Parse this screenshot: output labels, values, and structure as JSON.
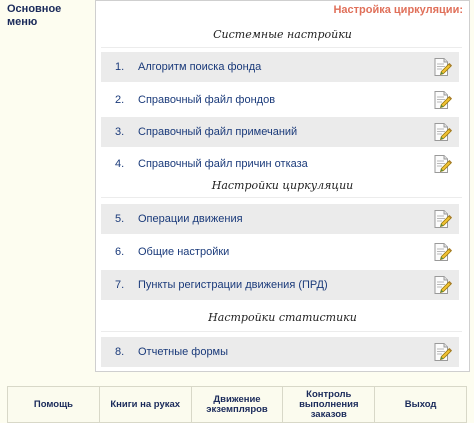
{
  "side_menu": {
    "title": "Основное меню"
  },
  "page_title": "Настройка циркуляции:",
  "sections": [
    {
      "title": "Системные настройки",
      "items": [
        {
          "num": "1.",
          "label": "Алгоритм поиска фонда"
        },
        {
          "num": "2.",
          "label": "Справочный файл фондов"
        },
        {
          "num": "3.",
          "label": "Справочный файл примечаний"
        },
        {
          "num": "4.",
          "label": "Справочный файл причин отказа"
        }
      ]
    },
    {
      "title": "Настройки циркуляции",
      "items": [
        {
          "num": "5.",
          "label": "Операции движения"
        },
        {
          "num": "6.",
          "label": "Общие настройки"
        },
        {
          "num": "7.",
          "label": "Пункты регистрации движения (ПРД)"
        }
      ]
    },
    {
      "title": "Настройки статистики",
      "items": [
        {
          "num": "8.",
          "label": "Отчетные формы"
        }
      ]
    }
  ],
  "footer": [
    "Помощь",
    "Книги на руках",
    "Движение экземпляров",
    "Контроль выполнения заказов",
    "Выход"
  ],
  "colors": {
    "page_title": "#e0705a",
    "text": "#1a2a5a",
    "row_shade": "#ebebeb",
    "background": "#fdfdf0"
  }
}
